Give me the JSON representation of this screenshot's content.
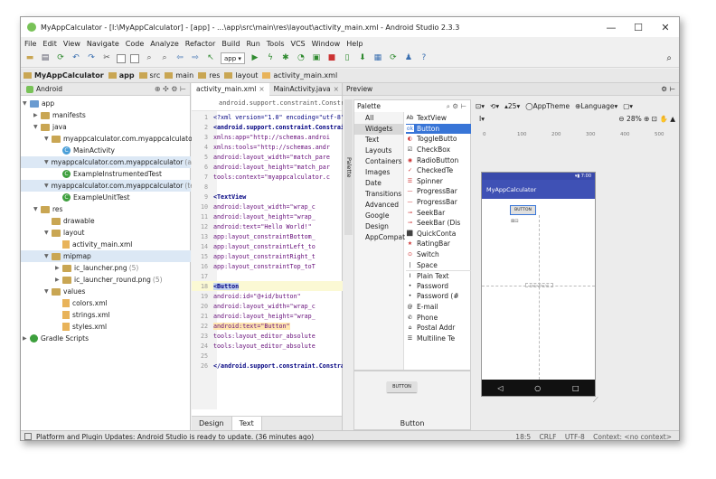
{
  "window": {
    "title": "MyAppCalculator - [I:\\MyAppCalculator] - [app] - ...\\app\\src\\main\\res\\layout\\activity_main.xml - Android Studio 2.3.3",
    "controls": [
      "—",
      "☐",
      "✕"
    ]
  },
  "menu": [
    "File",
    "Edit",
    "View",
    "Navigate",
    "Code",
    "Analyze",
    "Refactor",
    "Build",
    "Run",
    "Tools",
    "VCS",
    "Window",
    "Help"
  ],
  "toolbar": {
    "module_selector": "app ▾"
  },
  "breadcrumbs": [
    "MyAppCalculator",
    "app",
    "src",
    "main",
    "res",
    "layout",
    "activity_main.xml"
  ],
  "project": {
    "view_label": "Android",
    "tree": [
      {
        "label": "app",
        "sub": ""
      },
      {
        "label": "manifests",
        "sub": ""
      },
      {
        "label": "java",
        "sub": ""
      },
      {
        "label": "myappcalculator.com.myappcalculator",
        "sub": ""
      },
      {
        "label": "MainActivity",
        "sub": ""
      },
      {
        "label": "myappcalculator.com.myappcalculator",
        "sub": "(android"
      },
      {
        "label": "ExampleInstrumentedTest",
        "sub": ""
      },
      {
        "label": "myappcalculator.com.myappcalculator",
        "sub": "(test)"
      },
      {
        "label": "ExampleUnitTest",
        "sub": ""
      },
      {
        "label": "res",
        "sub": ""
      },
      {
        "label": "drawable",
        "sub": ""
      },
      {
        "label": "layout",
        "sub": ""
      },
      {
        "label": "activity_main.xml",
        "sub": ""
      },
      {
        "label": "mipmap",
        "sub": ""
      },
      {
        "label": "ic_launcher.png",
        "sub": "(5)"
      },
      {
        "label": "ic_launcher_round.png",
        "sub": "(5)"
      },
      {
        "label": "values",
        "sub": ""
      },
      {
        "label": "colors.xml",
        "sub": ""
      },
      {
        "label": "strings.xml",
        "sub": ""
      },
      {
        "label": "styles.xml",
        "sub": ""
      },
      {
        "label": "Gradle Scripts",
        "sub": ""
      }
    ]
  },
  "editor": {
    "tabs": [
      "activity_main.xml",
      "MainActivity.java"
    ],
    "breadcrumb": "android.support.constraint.Constra...",
    "lines": [
      {
        "n": "1",
        "text": "<?xml version=\"1.0\" encoding=\"utf-8\""
      },
      {
        "n": "2",
        "text": "<android.support.constraint.Constrai"
      },
      {
        "n": "3",
        "text": "    xmlns:app=\"http://schemas.androi"
      },
      {
        "n": "4",
        "text": "    xmlns:tools=\"http://schemas.andr"
      },
      {
        "n": "5",
        "text": "    android:layout_width=\"match_pare"
      },
      {
        "n": "6",
        "text": "    android:layout_height=\"match_par"
      },
      {
        "n": "7",
        "text": "    tools:context=\"myappcalculator.c"
      },
      {
        "n": "8",
        "text": ""
      },
      {
        "n": "9",
        "text": "    <TextView"
      },
      {
        "n": "10",
        "text": "        android:layout_width=\"wrap_c"
      },
      {
        "n": "11",
        "text": "        android:layout_height=\"wrap_"
      },
      {
        "n": "12",
        "text": "        android:text=\"Hello World!\""
      },
      {
        "n": "13",
        "text": "        app:layout_constraintBottom_"
      },
      {
        "n": "14",
        "text": "        app:layout_constraintLeft_to"
      },
      {
        "n": "15",
        "text": "        app:layout_constraintRight_t"
      },
      {
        "n": "16",
        "text": "        app:layout_constraintTop_toT"
      },
      {
        "n": "17",
        "text": ""
      },
      {
        "n": "18",
        "text": "    <Button"
      },
      {
        "n": "19",
        "text": "        android:id=\"@+id/button\""
      },
      {
        "n": "20",
        "text": "        android:layout_width=\"wrap_c"
      },
      {
        "n": "21",
        "text": "        android:layout_height=\"wrap_"
      },
      {
        "n": "22",
        "text": "        android:text=\"Button\""
      },
      {
        "n": "23",
        "text": "        tools:layout_editor_absolute"
      },
      {
        "n": "24",
        "text": "        tools:layout_editor_absolute"
      },
      {
        "n": "25",
        "text": ""
      },
      {
        "n": "26",
        "text": "</android.support.constraint.Constra"
      }
    ],
    "bottom_tabs": [
      "Design",
      "Text"
    ]
  },
  "preview": {
    "title": "Preview",
    "side_tab": "Palette",
    "palette_title": "Palette",
    "categories": [
      "All",
      "Widgets",
      "Text",
      "Layouts",
      "Containers",
      "Images",
      "Date",
      "Transitions",
      "Advanced",
      "Google",
      "Design",
      "AppCompat"
    ],
    "widgets": [
      {
        "icon": "Ab",
        "label": "TextView"
      },
      {
        "icon": "ok",
        "label": "Button"
      },
      {
        "icon": "◐",
        "label": "ToggleButto"
      },
      {
        "icon": "☑",
        "label": "CheckBox"
      },
      {
        "icon": "◉",
        "label": "RadioButton"
      },
      {
        "icon": "✓",
        "label": "CheckedTe"
      },
      {
        "icon": "☰",
        "label": "Spinner"
      },
      {
        "icon": "—",
        "label": "ProgressBar"
      },
      {
        "icon": "—",
        "label": "ProgressBar"
      },
      {
        "icon": "⊸",
        "label": "SeekBar"
      },
      {
        "icon": "⊸",
        "label": "SeekBar (Dis"
      },
      {
        "icon": "⬛",
        "label": "QuickConta"
      },
      {
        "icon": "★",
        "label": "RatingBar"
      },
      {
        "icon": "⊙",
        "label": "Switch"
      },
      {
        "icon": "|",
        "label": "Space"
      },
      {
        "icon": "I",
        "label": "Plain Text"
      },
      {
        "icon": "•",
        "label": "Password"
      },
      {
        "icon": "•",
        "label": "Password (#"
      },
      {
        "icon": "@",
        "label": "E-mail"
      },
      {
        "icon": "✆",
        "label": "Phone"
      },
      {
        "icon": "⌂",
        "label": "Postal Addr"
      },
      {
        "icon": "☰",
        "label": "Multiline Te"
      }
    ],
    "preview_button_text": "BUTTON",
    "preview_label": "Button",
    "api_level": "25",
    "theme": "AppTheme",
    "language": "Language",
    "zoom": "28%",
    "ruler_marks": [
      "0",
      "100",
      "200",
      "300",
      "400",
      "500"
    ],
    "phone": {
      "status_time": "7:00",
      "app_title": "MyAppCalculator",
      "button_text": "BUTTON",
      "hello_text": "Hello World!"
    }
  },
  "statusbar": {
    "message": "Platform and Plugin Updates: Android Studio is ready to update. (36 minutes ago)",
    "position": "18:5",
    "line_sep": "CRLF",
    "encoding": "UTF-8",
    "context": "Context: <no context>"
  },
  "colors": {
    "app_bar": "#3f51b5",
    "selection": "#3875d7",
    "android_green": "#78c257"
  }
}
